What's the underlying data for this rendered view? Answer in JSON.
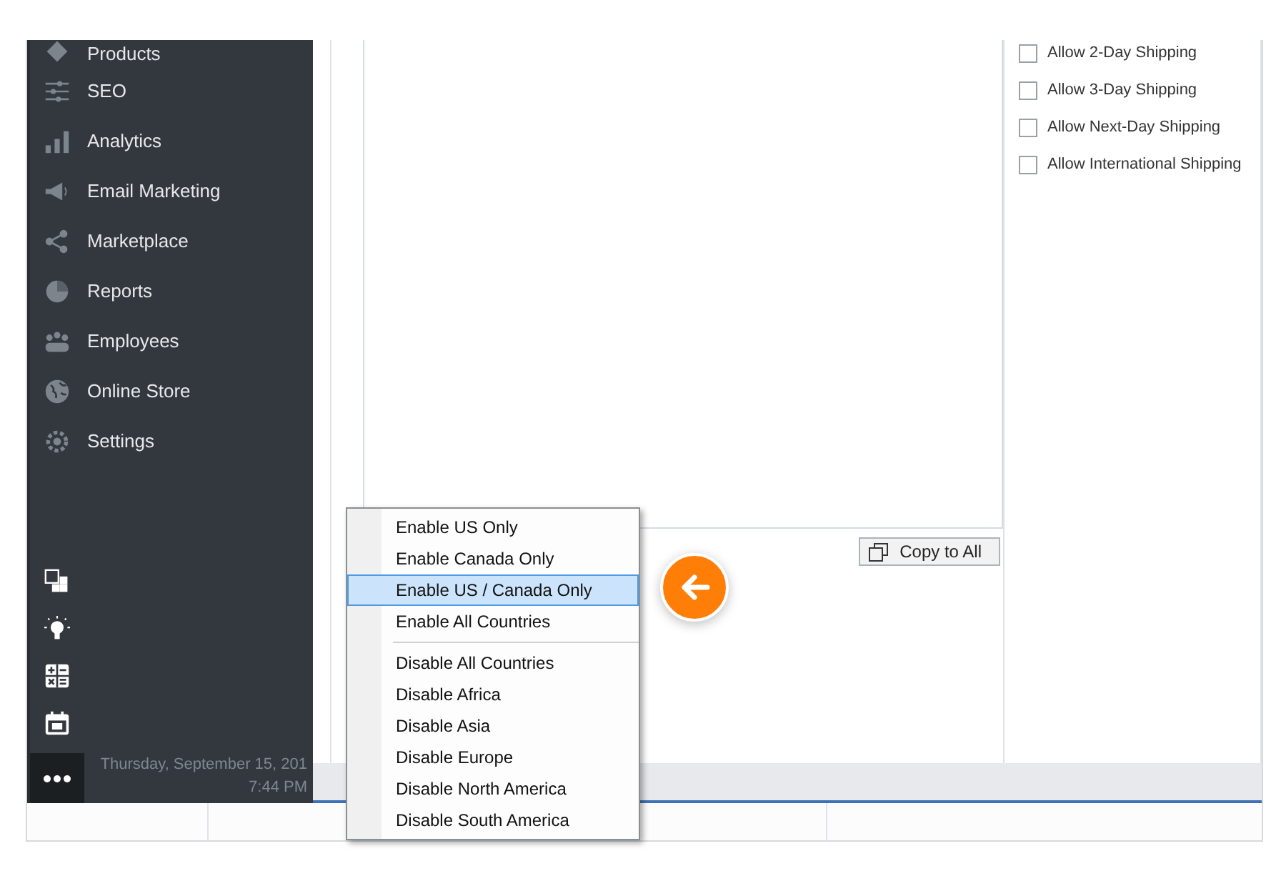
{
  "sidebar": {
    "items": [
      {
        "label": "Products",
        "selected": false
      },
      {
        "label": "SEO",
        "selected": false
      },
      {
        "label": "Analytics",
        "selected": false
      },
      {
        "label": "Email Marketing",
        "selected": false
      },
      {
        "label": "Marketplace",
        "selected": false
      },
      {
        "label": "Reports",
        "selected": false
      },
      {
        "label": "Employees",
        "selected": false
      },
      {
        "label": "Online Store",
        "selected": false
      },
      {
        "label": "Settings",
        "selected": false
      }
    ]
  },
  "taskbar": {
    "date": "Thursday, September 15, 201",
    "time": "7:44 PM"
  },
  "shipping_options": [
    {
      "label": "Allow 2-Day Shipping",
      "checked": false
    },
    {
      "label": "Allow 3-Day Shipping",
      "checked": false
    },
    {
      "label": "Allow Next-Day Shipping",
      "checked": false
    },
    {
      "label": "Allow International Shipping",
      "checked": false
    }
  ],
  "copy_button": {
    "label": "Copy to All"
  },
  "context_menu": {
    "groups": [
      [
        {
          "label": "Enable US Only",
          "selected": false
        },
        {
          "label": "Enable Canada Only",
          "selected": false
        },
        {
          "label": "Enable US / Canada Only",
          "selected": true
        },
        {
          "label": "Enable All Countries",
          "selected": false
        }
      ],
      [
        {
          "label": "Disable All Countries",
          "selected": false
        },
        {
          "label": "Disable Africa",
          "selected": false
        },
        {
          "label": "Disable Asia",
          "selected": false
        },
        {
          "label": "Disable Europe",
          "selected": false
        },
        {
          "label": "Disable North America",
          "selected": false
        },
        {
          "label": "Disable South America",
          "selected": false
        }
      ]
    ]
  }
}
